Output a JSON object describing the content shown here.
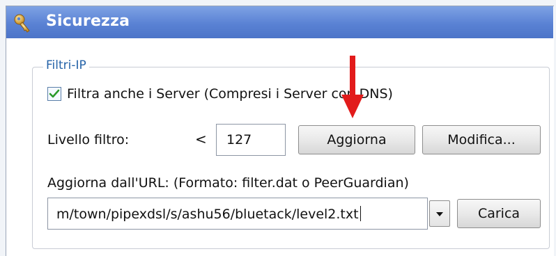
{
  "window": {
    "title": "Sicurezza"
  },
  "ip_filters": {
    "legend": "Filtri-IP",
    "filter_servers": {
      "label": "Filtra anche i Server (Compresi i Server con DNS)",
      "checked": true
    },
    "filter_level": {
      "label": "Livello filtro:",
      "operator": "<",
      "value": "127"
    },
    "update_button": "Aggiorna",
    "edit_button": "Modifica...",
    "url_label": "Aggiorna dall'URL: (Formato: filter.dat o PeerGuardian)",
    "url_value": "m/town/pipexdsl/s/ashu56/bluetack/level2.txt",
    "load_button": "Carica"
  },
  "colors": {
    "header": "#5a82d4",
    "legend_text": "#2563a8",
    "annotation_arrow": "#e21b1b",
    "check_mark": "#2a9a2a"
  },
  "icons": {
    "header": "key-icon",
    "dropdown": "triangle-down-icon"
  }
}
